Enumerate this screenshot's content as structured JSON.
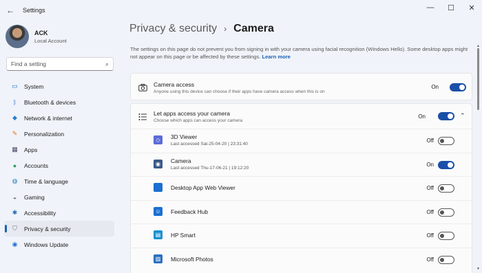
{
  "window": {
    "title": "Settings",
    "back_icon": "back-arrow-icon",
    "controls": [
      "—",
      "☐",
      "✕"
    ]
  },
  "profile": {
    "name": "ACK",
    "account_type": "Local Account"
  },
  "search": {
    "placeholder": "Find a setting",
    "icon": "search-icon"
  },
  "sidebar": {
    "items": [
      {
        "label": "System",
        "icon": "monitor-icon",
        "glyph": "▭",
        "color": "#1a6fd1"
      },
      {
        "label": "Bluetooth & devices",
        "icon": "bluetooth-icon",
        "glyph": "ᛒ",
        "color": "#1a6fd1"
      },
      {
        "label": "Network & internet",
        "icon": "wifi-icon",
        "glyph": "◆",
        "color": "#2680c9"
      },
      {
        "label": "Personalization",
        "icon": "brush-icon",
        "glyph": "✎",
        "color": "#e07b1f"
      },
      {
        "label": "Apps",
        "icon": "apps-icon",
        "glyph": "▦",
        "color": "#4a4a6a"
      },
      {
        "label": "Accounts",
        "icon": "person-icon",
        "glyph": "●",
        "color": "#2aa05a"
      },
      {
        "label": "Time & language",
        "icon": "globe-icon",
        "glyph": "◍",
        "color": "#2a7ab8"
      },
      {
        "label": "Gaming",
        "icon": "controller-icon",
        "glyph": "◒",
        "color": "#6b6b6b"
      },
      {
        "label": "Accessibility",
        "icon": "accessibility-icon",
        "glyph": "✱",
        "color": "#2a6fb8"
      },
      {
        "label": "Privacy & security",
        "icon": "shield-icon",
        "glyph": "⛉",
        "color": "#6b6b7a",
        "active": true
      },
      {
        "label": "Windows Update",
        "icon": "update-icon",
        "glyph": "◉",
        "color": "#1a6fd1"
      }
    ]
  },
  "main": {
    "breadcrumb_parent": "Privacy & security",
    "breadcrumb_sep": "›",
    "title": "Camera",
    "description": "The settings on this page do not prevent you from signing in with your camera using facial recognition (Windows Hello). Some desktop apps might not appear on this page or be affected by these settings.",
    "learn_more": "Learn more",
    "camera_access": {
      "title": "Camera access",
      "subtitle": "Anyone using this device can choose if their apps have camera access when this is on",
      "state": "On",
      "icon": "camera-icon"
    },
    "let_apps": {
      "title": "Let apps access your camera",
      "subtitle": "Choose which apps can access your camera",
      "state": "On",
      "icon": "list-icon",
      "expanded_icon": "chevron-up-icon"
    },
    "apps": [
      {
        "name": "3D Viewer",
        "last_accessed": "Last accessed Sat-25-04-20  |  23:31:40",
        "state": "Off",
        "on": false,
        "icon": "cube-icon",
        "color": "#5b6bd6",
        "glyph": "◇"
      },
      {
        "name": "Camera",
        "last_accessed": "Last accessed Thu-17-06-21  |  19:12:20",
        "state": "On",
        "on": true,
        "icon": "camera-app-icon",
        "color": "#3a5a8a",
        "glyph": "◉"
      },
      {
        "name": "Desktop App Web Viewer",
        "last_accessed": "",
        "state": "Off",
        "on": false,
        "icon": "app-tile-icon",
        "color": "#1a6fd1",
        "glyph": ""
      },
      {
        "name": "Feedback Hub",
        "last_accessed": "",
        "state": "Off",
        "on": false,
        "icon": "feedback-icon",
        "color": "#1a6fd1",
        "glyph": "☺"
      },
      {
        "name": "HP Smart",
        "last_accessed": "",
        "state": "Off",
        "on": false,
        "icon": "hp-smart-icon",
        "color": "#1a8fd1",
        "glyph": "▤"
      },
      {
        "name": "Microsoft Photos",
        "last_accessed": "",
        "state": "Off",
        "on": false,
        "icon": "photos-icon",
        "color": "#2a6fc1",
        "glyph": "▨"
      }
    ]
  }
}
